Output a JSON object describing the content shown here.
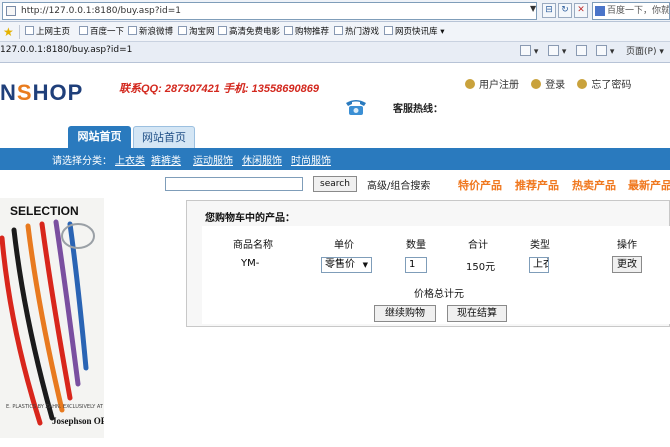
{
  "browser": {
    "address": "http://127.0.0.1:8180/buy.asp?id=1",
    "search_placeholder": "百度一下，你就知道",
    "favorites": [
      "上网主页",
      "百度一下",
      "新浪微博",
      "淘宝网",
      "高清免费电影",
      "购物推荐",
      "热门游戏",
      "网页快讯库"
    ],
    "tab_url": "127.0.0.1:8180/buy.asp?id=1",
    "page_menu": "页面(P)"
  },
  "header": {
    "logo_prefix": "N",
    "logo_s": "S",
    "logo_suffix": "HOP",
    "contact": "联系QQ: 287307421  手机: 13558690869",
    "hotline": "客服热线：",
    "links": [
      "用户注册",
      "登录",
      "忘了密码"
    ]
  },
  "nav": {
    "tabs": [
      "网站首页",
      "网站首页"
    ],
    "category_label": "请选择分类：",
    "categories": [
      "上衣类",
      "裤裤类",
      "运动服饰",
      "休闲服饰",
      "时尚服饰"
    ]
  },
  "search": {
    "button": "search",
    "advanced": "高级/组合搜索",
    "promos": [
      "特价产品",
      "推荐产品",
      "热卖产品",
      "最新产品"
    ]
  },
  "ad": {
    "title": "SELECTION",
    "footer": "E. PLASTICS BY ZAHN. EXCLUSIVELY AT",
    "brand": "Josephson OPTICIANS"
  },
  "cart": {
    "title": "您购物车中的产品：",
    "headers": [
      "商品名称",
      "单价",
      "数量",
      "合计",
      "类型",
      "操作"
    ],
    "row": {
      "name": "YM-",
      "price_option": "零售价",
      "quantity": "1",
      "subtotal": "150元",
      "type": "上衣",
      "update_button": "更改"
    },
    "total_label": "价格总计元",
    "continue_button": "继续购物",
    "checkout_button": "现在结算"
  },
  "colors": {
    "nav_blue": "#2a7abe",
    "promo_orange": "#f0781f",
    "contact_red": "#d3281e"
  }
}
